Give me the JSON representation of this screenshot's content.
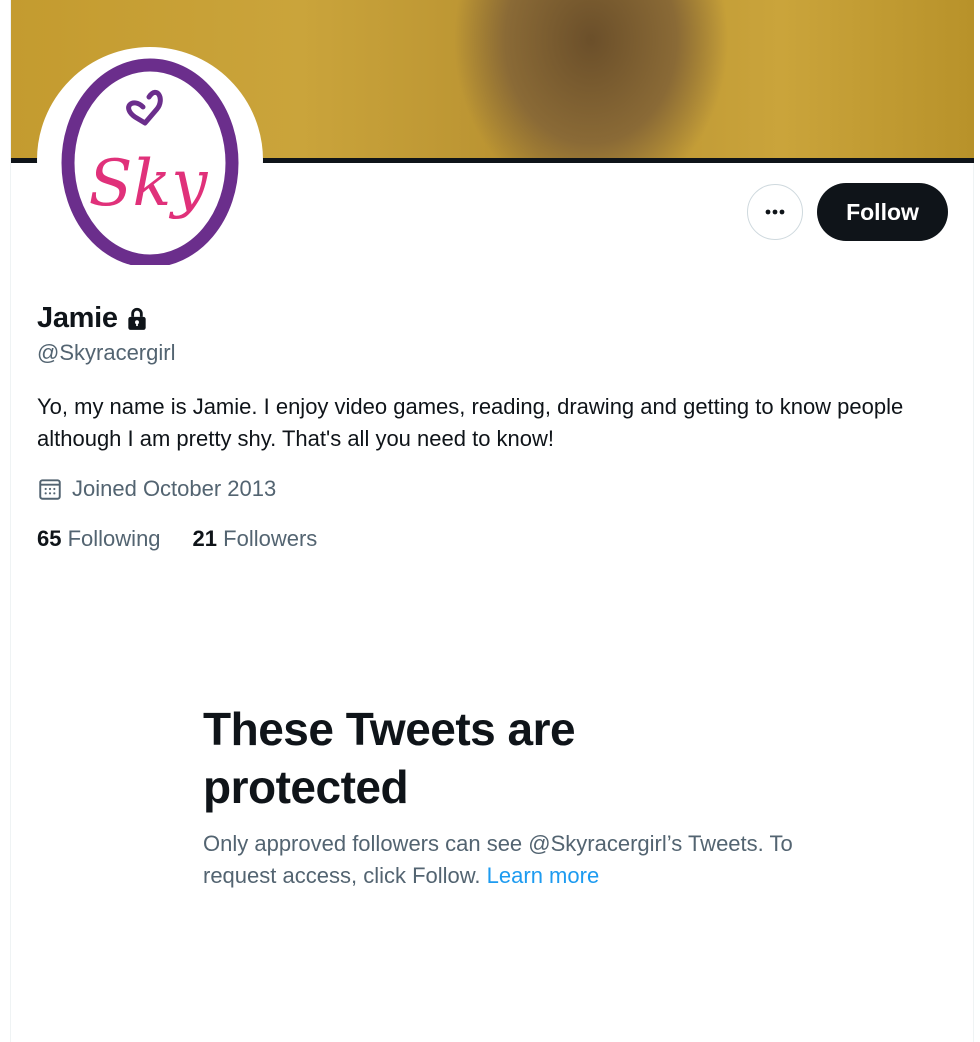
{
  "profile": {
    "avatar_text": "Sky",
    "name": "Jamie",
    "handle": "@Skyracergirl",
    "bio": "Yo, my name is Jamie. I enjoy video games, reading, drawing and getting to know people although I am pretty shy. That's all you need to know!",
    "joined": "Joined October 2013",
    "following_count": "65",
    "following_label": "Following",
    "followers_count": "21",
    "followers_label": "Followers"
  },
  "actions": {
    "follow_label": "Follow",
    "more_icon": "more-horizontal-icon"
  },
  "protected": {
    "title": "These Tweets are protected",
    "description": "Only approved followers can see @Skyracergirl’s Tweets. To request access, click Follow.",
    "learn_more": "Learn more"
  },
  "colors": {
    "text_primary": "#0f1419",
    "text_secondary": "#536471",
    "link": "#1d9bf0",
    "avatar_ring": "#6b2e8c",
    "avatar_text": "#e0317a"
  }
}
